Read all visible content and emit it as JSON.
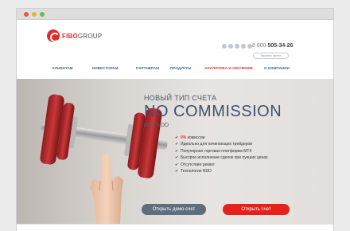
{
  "brand": {
    "name_part1": "FIBO",
    "name_part2": "GROUP",
    "accent": "#e52c2c"
  },
  "header": {
    "phone_prefix": "8 800 ",
    "phone_number": "505-34-26",
    "callback_label": "Заказать звонок",
    "socials": [
      "facebook-icon",
      "twitter-icon",
      "vk-icon",
      "google-plus-icon",
      "odnoklassniki-icon"
    ]
  },
  "nav": {
    "items": [
      {
        "label": "КЛИЕНТАМ"
      },
      {
        "label": "ИНВЕСТОРАМ"
      },
      {
        "label": "ПАРТНЕРАМ"
      },
      {
        "label": "ПРОДУКТЫ"
      },
      {
        "label": "АНАЛИТИКА И ОБУЧЕНИЕ",
        "active": true
      },
      {
        "label": "О КОМПАНИИ"
      }
    ]
  },
  "hero": {
    "subtitle": "НОВЫЙ ТИП СЧЕТА",
    "title": "NO COMMISSION",
    "tag": "MT4 NDD",
    "features": [
      {
        "highlight": "0%",
        "text": " комиссии"
      },
      {
        "text": "Идеально для начинающих трейдеров"
      },
      {
        "text": "Популярная торговая платформа МТ4"
      },
      {
        "text": "Быстрое исполнение сделок при лучших ценах"
      },
      {
        "text": "Отсутствие реквот"
      },
      {
        "text": "Технология NDD"
      }
    ],
    "btn_demo": "Открыть демо-счет",
    "btn_real": "Открыть счет"
  }
}
